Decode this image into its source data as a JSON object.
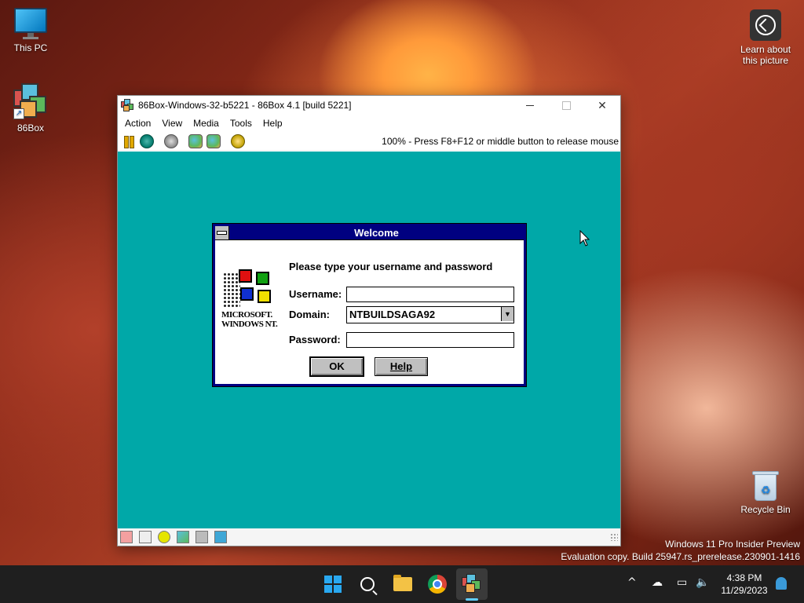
{
  "desktop": {
    "icons": {
      "this_pc": "This PC",
      "box86": "86Box",
      "learn": "Learn about this picture",
      "recycle_bin": "Recycle Bin"
    },
    "watermark": {
      "line1": "Windows 11 Pro Insider Preview",
      "line2": "Evaluation copy. Build 25947.rs_prerelease.230901-1416"
    }
  },
  "window": {
    "title": "86Box-Windows-32-b5221 - 86Box 4.1 [build 5221]",
    "menu": [
      "Action",
      "View",
      "Media",
      "Tools",
      "Help"
    ],
    "toolbar_status": "100% - Press F8+F12 or middle button to release mouse",
    "screen_color": "#00a8a8"
  },
  "dialog": {
    "title": "Welcome",
    "message": "Please type your username and password",
    "logo_text_1": "MICROSOFT.",
    "logo_text_2": "WINDOWS NT.",
    "username_label": "Username:",
    "username_value": "",
    "domain_label": "Domain:",
    "domain_value": "NTBUILDSAGA92",
    "password_label": "Password:",
    "password_value": "",
    "ok_label": "OK",
    "help_label": "Help"
  },
  "taskbar": {
    "time": "4:38 PM",
    "date": "11/29/2023"
  }
}
